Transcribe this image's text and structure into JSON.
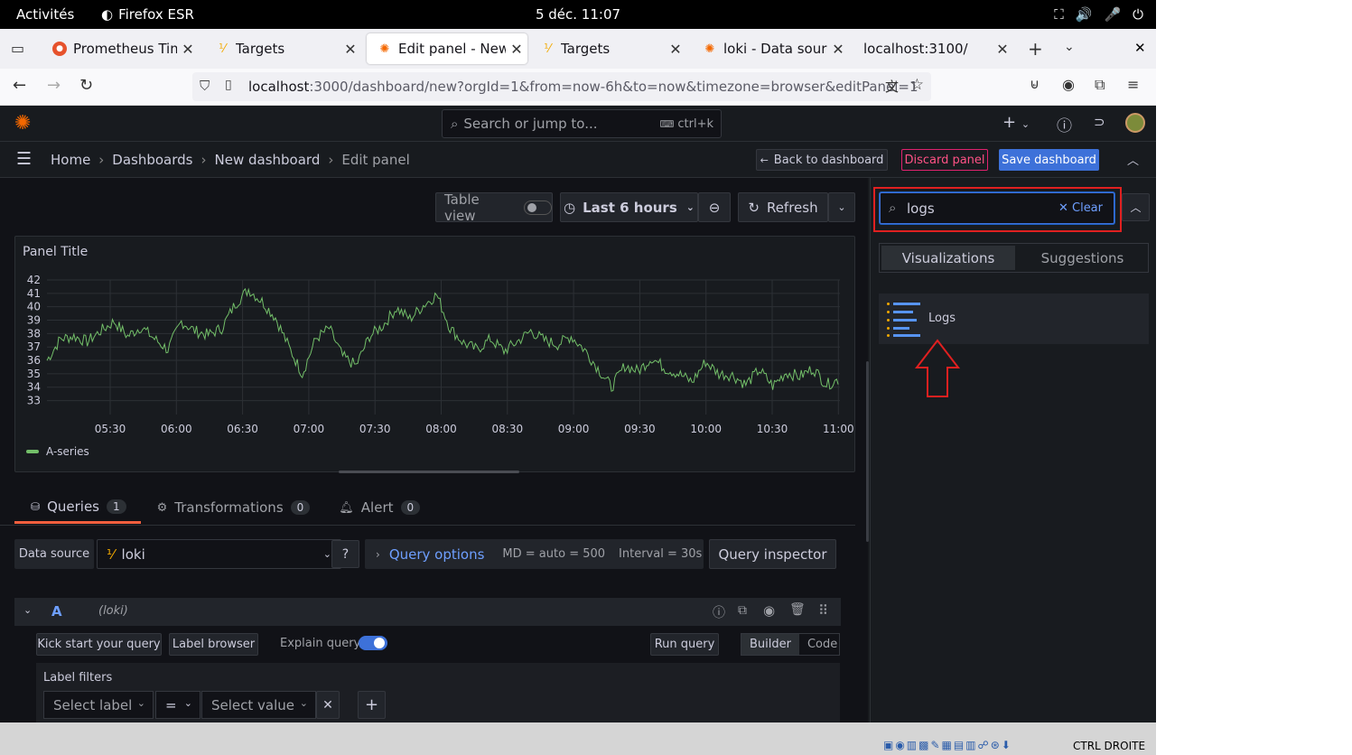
{
  "os": {
    "activities": "Activités",
    "app": "Firefox ESR",
    "clock": "5 déc.  11:07",
    "tray": [
      "⛶",
      "🔊",
      "🎤",
      "⏻"
    ],
    "status": "CTRL DROITE"
  },
  "tabs": [
    {
      "title": "Prometheus Time",
      "icon": "prometheus-icon"
    },
    {
      "title": "Targets",
      "icon": "loki-icon"
    },
    {
      "title": "Edit panel - New da",
      "icon": "grafana-icon"
    },
    {
      "title": "Targets",
      "icon": "loki-icon"
    },
    {
      "title": "loki - Data sources",
      "icon": "grafana-icon"
    },
    {
      "title": "localhost:3100/",
      "icon": ""
    }
  ],
  "url": {
    "host": "localhost",
    "rest": ":3000/dashboard/new?orgId=1&from=now-6h&to=now&timezone=browser&editPanel=1"
  },
  "grafana": {
    "search_placeholder": "Search or jump to...",
    "search_shortcut": "ctrl+k",
    "breadcrumbs": [
      "Home",
      "Dashboards",
      "New dashboard",
      "Edit panel"
    ],
    "back": "Back to dashboard",
    "discard": "Discard panel",
    "save": "Save dashboard",
    "table_view": "Table view",
    "time_range": "Last 6 hours",
    "refresh": "Refresh",
    "panel_title": "Panel Title",
    "legend": "A-series",
    "tabs": [
      {
        "label": "Queries",
        "count": "1"
      },
      {
        "label": "Transformations",
        "count": "0"
      },
      {
        "label": "Alert",
        "count": "0"
      }
    ],
    "data_source_label": "Data source",
    "data_source": "loki",
    "query_options": "Query options",
    "md": "MD = auto = 500",
    "interval": "Interval = 30s",
    "inspector": "Query inspector",
    "query_letter": "A",
    "query_ds": "(loki)",
    "kick": "Kick start your query",
    "label_browser": "Label browser",
    "explain": "Explain query",
    "run": "Run query",
    "builder": "Builder",
    "code": "Code",
    "label_filters": "Label filters",
    "select_label": "Select label",
    "op": "=",
    "select_value": "Select value"
  },
  "viz": {
    "search_value": "logs",
    "clear": "Clear",
    "tab1": "Visualizations",
    "tab2": "Suggestions",
    "result": "Logs"
  },
  "colors": {
    "series": "#73bf69",
    "primary": "#3d71d9",
    "danger": "#e0226e",
    "highlight": "#e02020"
  },
  "chart_data": {
    "type": "line",
    "xlabels": [
      "05:30",
      "06:00",
      "06:30",
      "07:00",
      "07:30",
      "08:00",
      "08:30",
      "09:00",
      "09:30",
      "10:00",
      "10:30",
      "11:00"
    ],
    "ylabels": [
      "42",
      "41",
      "40",
      "39",
      "38",
      "37",
      "36",
      "35",
      "34",
      "33"
    ],
    "ylim": [
      32.5,
      42
    ],
    "series": [
      {
        "name": "A-series",
        "values": [
          36.0,
          37.6,
          37.8,
          37.4,
          38.2,
          38.9,
          37.8,
          38.5,
          37.6,
          36.8,
          38.9,
          38.2,
          37.9,
          38.4,
          40.2,
          41.3,
          40.4,
          39.2,
          37.0,
          35.0,
          37.6,
          38.4,
          36.3,
          35.6,
          37.8,
          38.6,
          39.9,
          39.1,
          40.1,
          40.9,
          38.4,
          37.3,
          36.8,
          37.6,
          36.7,
          37.4,
          38.2,
          37.5,
          37.2,
          37.8,
          36.8,
          35.4,
          34.0,
          35.6,
          35.2,
          36.2,
          35.4,
          35.0,
          34.4,
          35.9,
          35.0,
          34.9,
          34.2,
          35.3,
          34.1,
          35.1,
          34.8,
          35.4,
          34.2,
          34.6
        ]
      }
    ]
  }
}
